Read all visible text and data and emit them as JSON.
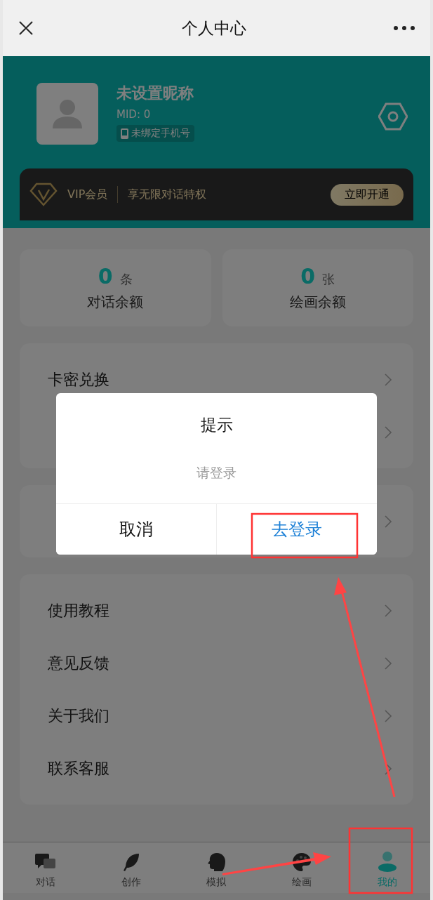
{
  "top_bar": {
    "title": "个人中心"
  },
  "profile": {
    "nickname": "未设置昵称",
    "mid": "MID: 0",
    "phone_badge": "未绑定手机号"
  },
  "vip": {
    "label": "VIP会员",
    "slogan": "享无限对话特权",
    "button": "立即开通"
  },
  "stats": [
    {
      "value": "0",
      "unit": "条",
      "label": "对话余额"
    },
    {
      "value": "0",
      "unit": "张",
      "label": "绘画余额"
    }
  ],
  "menu_groups": [
    {
      "items": [
        {
          "kind": "text",
          "label": "卡密兑换"
        },
        {
          "kind": "covered"
        }
      ]
    },
    {
      "items": [
        {
          "kind": "covered"
        }
      ]
    },
    {
      "items": [
        {
          "kind": "text",
          "label": "使用教程"
        },
        {
          "kind": "text",
          "label": "意见反馈"
        },
        {
          "kind": "text",
          "label": "关于我们"
        },
        {
          "kind": "text",
          "label": "联系客服"
        }
      ]
    }
  ],
  "dialog": {
    "title": "提示",
    "message": "请登录",
    "buttons": [
      {
        "label": "取消",
        "kind": "cancel"
      },
      {
        "label": "去登录",
        "kind": "confirm"
      }
    ]
  },
  "tab_bar": [
    {
      "label": "对话",
      "selected": false
    },
    {
      "label": "创作",
      "selected": false
    },
    {
      "label": "模拟",
      "selected": false
    },
    {
      "label": "绘画",
      "selected": false
    },
    {
      "label": "我的",
      "selected": true
    }
  ]
}
